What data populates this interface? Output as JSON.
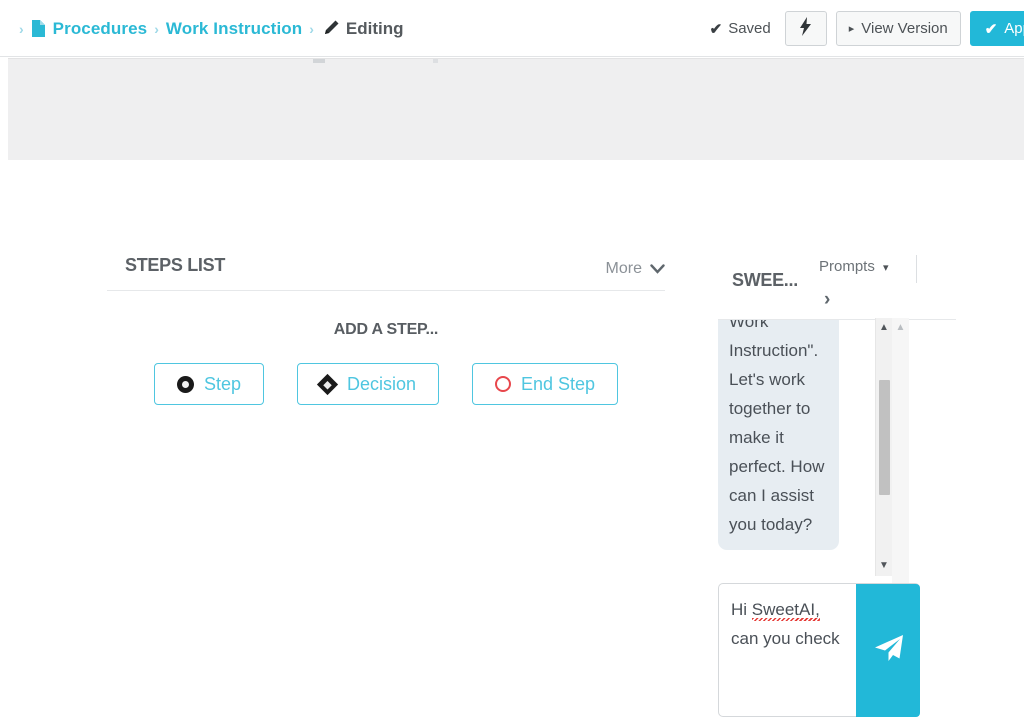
{
  "theme": {
    "accent": "#22B8D8",
    "accent_light": "#4FC6E0",
    "danger": "#e8474c",
    "text_dark": "#4d5256",
    "panel_gray": "#efeff0",
    "bubble_bg": "#e7edf2"
  },
  "header": {
    "home_icon": "sitemap-icon",
    "separator": "›",
    "breadcrumb": [
      {
        "label": "Procedures",
        "icon": "document-icon",
        "current": false
      },
      {
        "label": "Work Instruction",
        "icon": "",
        "current": false
      },
      {
        "label": "Editing",
        "icon": "pencil-icon",
        "current": true
      }
    ],
    "saved_status": "Saved",
    "saved_tick": "✔",
    "bolt_button": "⚡",
    "view_version_label": "View Version",
    "view_version_caret": "▸",
    "approve_label": "App",
    "approve_tick": "✔"
  },
  "steps_panel": {
    "title": "STEPS LIST",
    "more_label": "More",
    "more_chevron": "⌄",
    "add_step_label": "ADD A STEP...",
    "buttons": [
      {
        "label": "Step",
        "icon": "filled-circle-icon"
      },
      {
        "label": "Decision",
        "icon": "diamond-icon"
      },
      {
        "label": "End Step",
        "icon": "red-circle-outline-icon"
      }
    ]
  },
  "chat_panel": {
    "title": "SWEE...",
    "prompts_label": "Prompts",
    "prompts_caret": "▾",
    "expand_chevron": "›",
    "message": "Work Instruction\". Let's work together to make it perfect. How can I assist you today?",
    "input_value_part1": "Hi ",
    "input_value_misspelled": "SweetAI,",
    "input_value_part2": " can you check",
    "send_icon": "paper-plane-icon",
    "scroll_up_arrow": "▲",
    "scroll_down_arrow": "▼"
  }
}
